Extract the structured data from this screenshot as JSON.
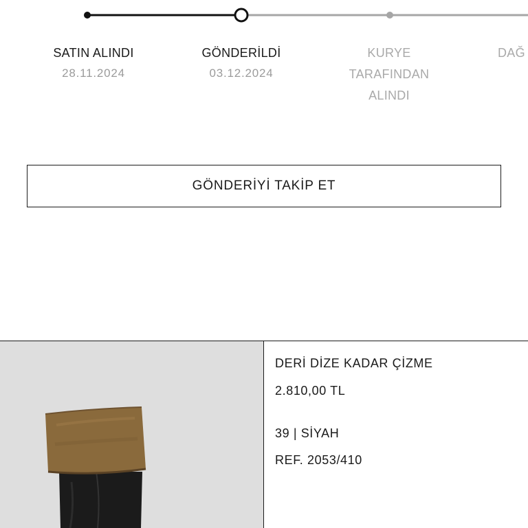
{
  "tracking": {
    "steps": [
      {
        "label": "SATIN ALINDI",
        "date": "28.11.2024",
        "status": "done"
      },
      {
        "label": "GÖNDERİLDİ",
        "date": "03.12.2024",
        "status": "current"
      },
      {
        "label": "KURYE TARAFINDAN ALINDI",
        "date": "",
        "status": "pending"
      },
      {
        "label": "DAĞ",
        "date": "",
        "status": "pending"
      }
    ],
    "colors": {
      "done": "#111111",
      "pending": "#a6a6a6"
    }
  },
  "track_button": {
    "label": "GÖNDERİYİ TAKİP ET"
  },
  "product": {
    "image_alt_icon": "boot-image",
    "name": "DERİ DİZE KADAR ÇİZME",
    "price": "2.810,00 TL",
    "variant": "39 | SİYAH",
    "ref": "REF. 2053/410"
  }
}
